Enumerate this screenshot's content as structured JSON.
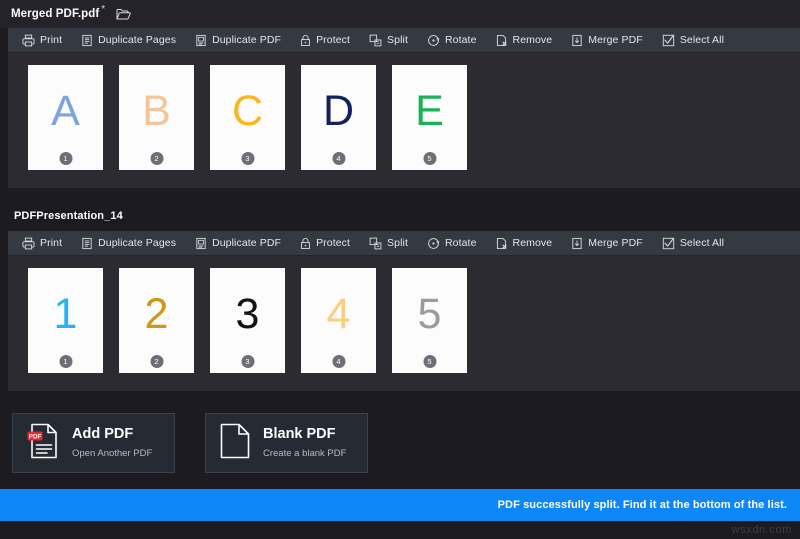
{
  "titlebar": {
    "document_name": "Merged PDF.pdf",
    "dirty_marker": "*",
    "open_folder_icon": "open-folder-icon"
  },
  "toolbar_items": [
    {
      "label": "Print",
      "icon": "printer-icon"
    },
    {
      "label": "Duplicate Pages",
      "icon": "duplicate-pages-icon"
    },
    {
      "label": "Duplicate PDF",
      "icon": "duplicate-pdf-icon"
    },
    {
      "label": "Protect",
      "icon": "lock-icon"
    },
    {
      "label": "Split",
      "icon": "split-icon"
    },
    {
      "label": "Rotate",
      "icon": "rotate-icon"
    },
    {
      "label": "Remove",
      "icon": "remove-page-icon"
    },
    {
      "label": "Merge PDF",
      "icon": "merge-pdf-icon"
    },
    {
      "label": "Select All",
      "icon": "checkbox-check-icon"
    }
  ],
  "documents": [
    {
      "name": "Merged PDF.pdf",
      "pages": [
        {
          "glyph": "A",
          "color": "#7ba3dd",
          "number": "1"
        },
        {
          "glyph": "B",
          "color": "#f4c49b",
          "number": "2"
        },
        {
          "glyph": "C",
          "color": "#fcb61a",
          "number": "3"
        },
        {
          "glyph": "D",
          "color": "#12205e",
          "number": "4"
        },
        {
          "glyph": "E",
          "color": "#19b356",
          "number": "5"
        }
      ]
    },
    {
      "name": "PDFPresentation_14",
      "pages": [
        {
          "glyph": "1",
          "color": "#26b3f0",
          "number": "1"
        },
        {
          "glyph": "2",
          "color": "#cf9714",
          "number": "2"
        },
        {
          "glyph": "3",
          "color": "#121212",
          "number": "3"
        },
        {
          "glyph": "4",
          "color": "#f8cf81",
          "number": "4"
        },
        {
          "glyph": "5",
          "color": "#9b9b9b",
          "number": "5"
        }
      ]
    }
  ],
  "cards": [
    {
      "title": "Add PDF",
      "subtitle": "Open Another PDF",
      "icon": "pdf-document-icon"
    },
    {
      "title": "Blank PDF",
      "subtitle": "Create a blank PDF",
      "icon": "blank-document-icon"
    }
  ],
  "statusbar": {
    "message": "PDF successfully split. Find it at the bottom of the list.",
    "color": "#0d87f7"
  },
  "watermark": {
    "text": "wsxdn.com"
  }
}
